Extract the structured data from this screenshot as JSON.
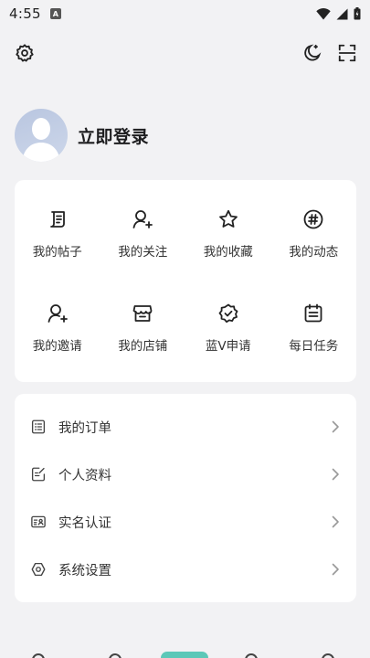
{
  "status_bar": {
    "time": "4:55",
    "notif_badge": "A"
  },
  "top_actions": {
    "settings_icon": "gear-icon",
    "night_icon": "moon-icon",
    "scan_icon": "scan-icon"
  },
  "profile": {
    "login_label": "立即登录"
  },
  "grid": {
    "items": [
      {
        "label": "我的帖子",
        "icon": "post-icon"
      },
      {
        "label": "我的关注",
        "icon": "user-add-icon"
      },
      {
        "label": "我的收藏",
        "icon": "star-icon"
      },
      {
        "label": "我的动态",
        "icon": "hashtag-icon"
      },
      {
        "label": "我的邀请",
        "icon": "user-add-icon"
      },
      {
        "label": "我的店铺",
        "icon": "store-icon"
      },
      {
        "label": "蓝V申请",
        "icon": "verified-badge-icon"
      },
      {
        "label": "每日任务",
        "icon": "calendar-icon"
      }
    ]
  },
  "list": {
    "items": [
      {
        "label": "我的订单",
        "icon": "order-list-icon"
      },
      {
        "label": "个人资料",
        "icon": "edit-profile-icon"
      },
      {
        "label": "实名认证",
        "icon": "id-card-icon"
      },
      {
        "label": "系统设置",
        "icon": "hexagon-settings-icon"
      }
    ]
  },
  "colors": {
    "background": "#f2f2f4",
    "card": "#ffffff",
    "accent": "#5cc8b8",
    "text": "#333333"
  }
}
